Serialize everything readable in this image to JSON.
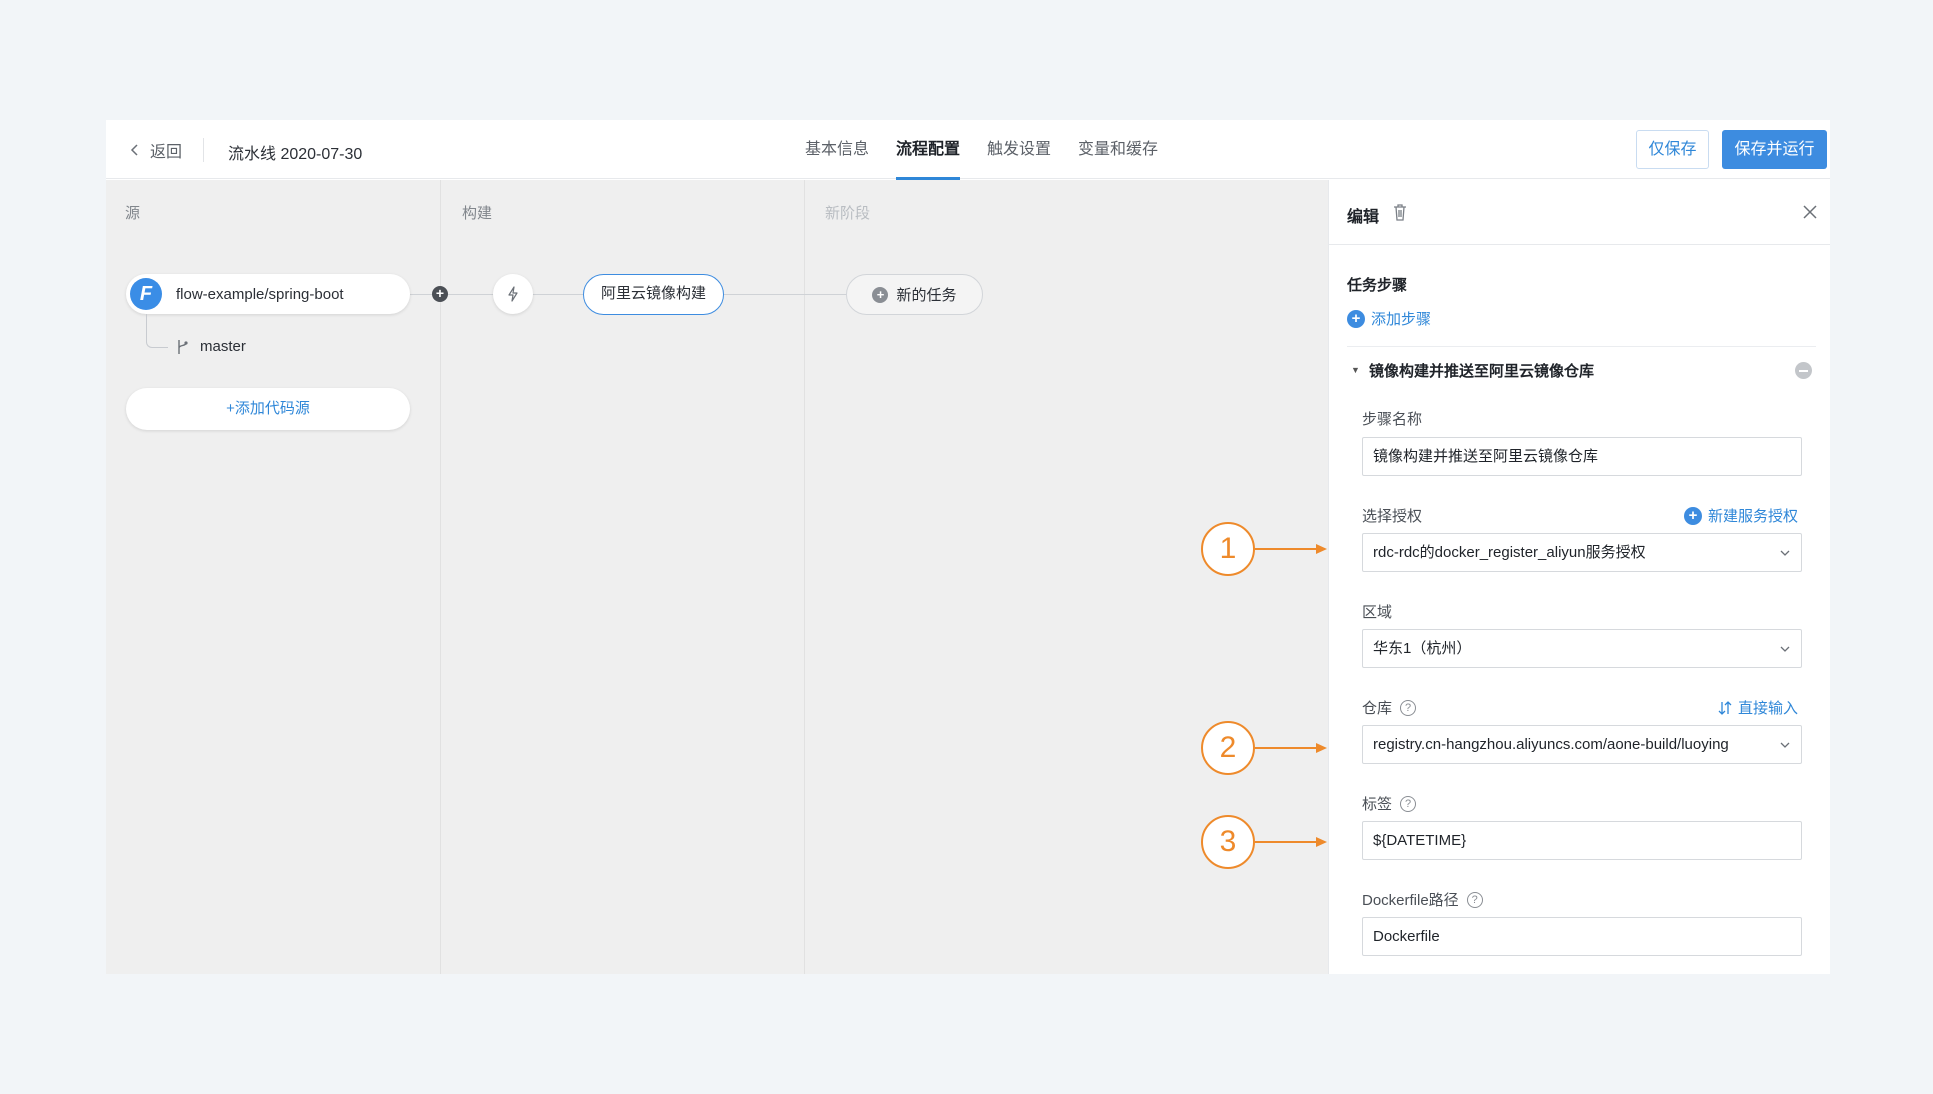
{
  "header": {
    "back_label": "返回",
    "pipeline_title": "流水线 2020-07-30",
    "tabs": [
      {
        "label": "基本信息"
      },
      {
        "label": "流程配置"
      },
      {
        "label": "触发设置"
      },
      {
        "label": "变量和缓存"
      }
    ],
    "save_only_label": "仅保存",
    "save_and_run_label": "保存并运行"
  },
  "canvas": {
    "stages": [
      {
        "label": "源"
      },
      {
        "label": "构建"
      },
      {
        "label": "新阶段"
      }
    ],
    "source": {
      "logo_letter": "F",
      "repo": "flow-example/spring-boot",
      "branch": "master",
      "add_source_label": "+添加代码源"
    },
    "build_task_label": "阿里云镜像构建",
    "new_task_label": "新的任务",
    "accent_color": "#3d8ce0"
  },
  "panel": {
    "title": "编辑",
    "section_title": "任务步骤",
    "add_step_label": "添加步骤",
    "group_title": "镜像构建并推送至阿里云镜像仓库",
    "fields": {
      "step_name_label": "步骤名称",
      "step_name_value": "镜像构建并推送至阿里云镜像仓库",
      "auth_label": "选择授权",
      "auth_action_label": "新建服务授权",
      "auth_value": "rdc-rdc的docker_register_aliyun服务授权",
      "region_label": "区域",
      "region_value": "华东1（杭州）",
      "repo_label": "仓库",
      "repo_action_label": "直接输入",
      "repo_value": "registry.cn-hangzhou.aliyuncs.com/aone-build/luoying",
      "tag_label": "标签",
      "tag_value": "${DATETIME}",
      "dockerfile_label": "Dockerfile路径",
      "dockerfile_value": "Dockerfile"
    }
  },
  "annotations": [
    {
      "number": "1"
    },
    {
      "number": "2"
    },
    {
      "number": "3"
    }
  ],
  "annotation_color": "#ee8a2b"
}
